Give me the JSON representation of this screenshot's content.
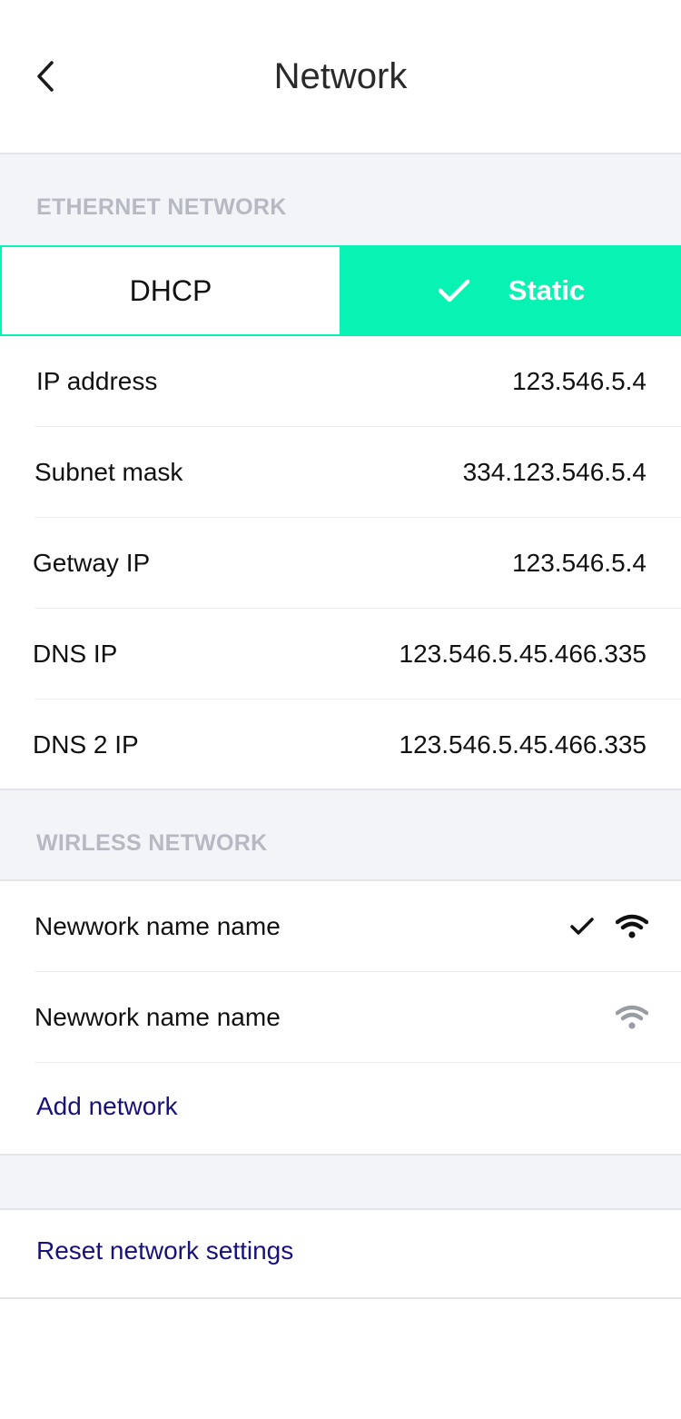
{
  "header": {
    "title": "Network"
  },
  "ethernet": {
    "section_title": "ETHERNET NETWORK",
    "modes": {
      "dhcp": "DHCP",
      "static": "Static",
      "selected": "static"
    },
    "fields": [
      {
        "label": "IP address",
        "value": "123.546.5.4"
      },
      {
        "label": "Subnet mask",
        "value": "334.123.546.5.4"
      },
      {
        "label": "Getway IP",
        "value": "123.546.5.4"
      },
      {
        "label": "DNS IP",
        "value": "123.546.5.45.466.335"
      },
      {
        "label": "DNS 2 IP",
        "value": "123.546.5.45.466.335"
      }
    ]
  },
  "wireless": {
    "section_title": "WIRLESS NETWORK",
    "networks": [
      {
        "name": "Newwork name name",
        "connected": true,
        "icon": "wifi-icon"
      },
      {
        "name": "Newwork name name",
        "connected": false,
        "icon": "wifi-icon"
      }
    ],
    "add_label": "Add network"
  },
  "reset_label": "Reset network settings",
  "colors": {
    "accent": "#08f2b3",
    "link": "#16127a",
    "section_bg": "#f3f4f8"
  }
}
